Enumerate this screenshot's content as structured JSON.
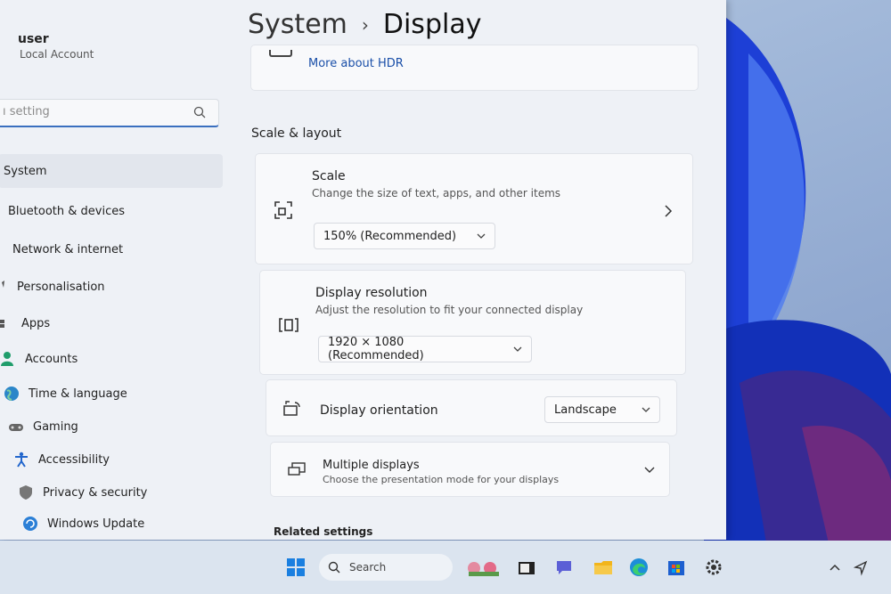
{
  "user": {
    "name": "user",
    "account": "Local Account"
  },
  "search": {
    "placeholder": "ı setting"
  },
  "sidebar": {
    "items": [
      {
        "label": "System",
        "icon": "system-icon"
      },
      {
        "label": "Bluetooth & devices",
        "icon": "bluetooth-icon"
      },
      {
        "label": "Network & internet",
        "icon": "network-icon"
      },
      {
        "label": "Personalisation",
        "icon": "brush-icon"
      },
      {
        "label": "Apps",
        "icon": "apps-icon"
      },
      {
        "label": "Accounts",
        "icon": "accounts-icon"
      },
      {
        "label": "Time & language",
        "icon": "globe-icon"
      },
      {
        "label": "Gaming",
        "icon": "gamepad-icon"
      },
      {
        "label": "Accessibility",
        "icon": "accessibility-icon"
      },
      {
        "label": "Privacy & security",
        "icon": "shield-icon"
      },
      {
        "label": "Windows Update",
        "icon": "update-icon"
      }
    ]
  },
  "header": {
    "parent": "System",
    "separator": "›",
    "current": "Display"
  },
  "hdr": {
    "link": "More about HDR"
  },
  "scale_layout": {
    "heading": "Scale & layout",
    "scale": {
      "title": "Scale",
      "subtitle": "Change the size of text, apps, and other items",
      "value": "150% (Recommended)"
    },
    "resolution": {
      "title": "Display resolution",
      "subtitle": "Adjust the resolution to fit your connected display",
      "value": "1920 × 1080 (Recommended)"
    },
    "orientation": {
      "title": "Display orientation",
      "value": "Landscape"
    },
    "multiple": {
      "title": "Multiple displays",
      "subtitle": "Choose the presentation mode for your displays"
    }
  },
  "related": {
    "heading": "Related settings"
  },
  "taskbar": {
    "search_label": "Search"
  },
  "colors": {
    "accent": "#3a6fbf",
    "window": "#eef1f6",
    "card": "#f8f9fb"
  }
}
